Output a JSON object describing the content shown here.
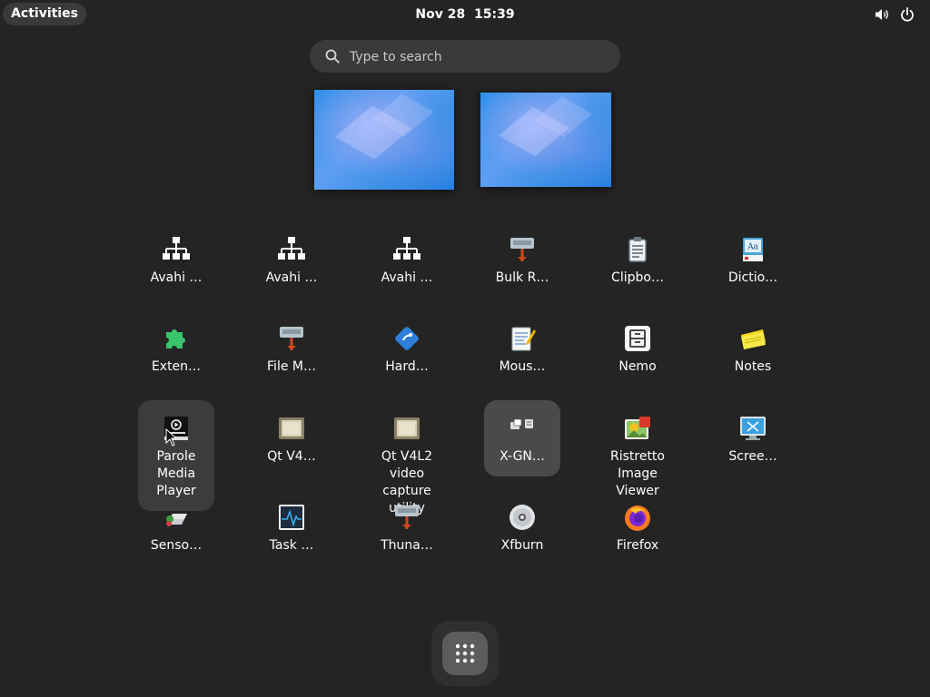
{
  "topbar": {
    "activities_label": "Activities",
    "date": "Nov 28",
    "time": "15:39",
    "icons": [
      "volume-icon",
      "power-icon"
    ]
  },
  "search": {
    "placeholder": "Type to search"
  },
  "workspaces": [
    {
      "name": "workspace-1"
    },
    {
      "name": "workspace-2"
    }
  ],
  "apps": [
    {
      "label": "Avahi …",
      "icon": "network-icon"
    },
    {
      "label": "Avahi …",
      "icon": "network-icon"
    },
    {
      "label": "Avahi …",
      "icon": "network-icon"
    },
    {
      "label": "Bulk R…",
      "icon": "bulk-rename-icon"
    },
    {
      "label": "Clipbo…",
      "icon": "clipboard-icon"
    },
    {
      "label": "Dictio…",
      "icon": "dictionary-icon"
    },
    {
      "label": "Exten…",
      "icon": "puzzle-icon"
    },
    {
      "label": "File M…",
      "icon": "file-manager-icon"
    },
    {
      "label": "Hard…",
      "icon": "hardinfo-icon"
    },
    {
      "label": "Mous…",
      "icon": "mousepad-icon"
    },
    {
      "label": "Nemo",
      "icon": "nemo-icon"
    },
    {
      "label": "Notes",
      "icon": "notes-icon"
    },
    {
      "label": "Parole Media Player",
      "icon": "media-player-icon"
    },
    {
      "label": "Qt V4…",
      "icon": "qt-v4l2-icon"
    },
    {
      "label": "Qt V4L2 video capture utility",
      "icon": "qt-v4l2-capture-icon"
    },
    {
      "label": "X-GN…",
      "icon": "app-folder-icon"
    },
    {
      "label": "Ristretto Image Viewer",
      "icon": "image-viewer-icon"
    },
    {
      "label": "Scree…",
      "icon": "screenshot-icon"
    },
    {
      "label": "Senso…",
      "icon": "sensors-icon"
    },
    {
      "label": "Task …",
      "icon": "task-manager-icon"
    },
    {
      "label": "Thuna…",
      "icon": "thunar-icon"
    },
    {
      "label": "Xfburn",
      "icon": "disc-burner-icon"
    },
    {
      "label": "Firefox",
      "icon": "firefox-icon"
    }
  ],
  "dock": {
    "show_apps_icon": "grid-icon"
  }
}
